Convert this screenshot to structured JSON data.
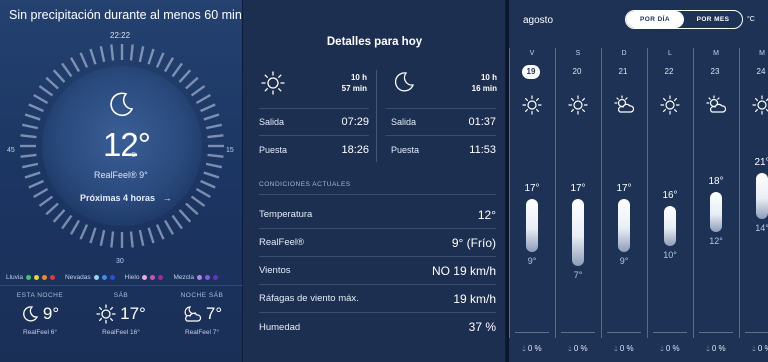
{
  "left": {
    "headline": "Sin precipitación durante al menos 60 min",
    "dial": {
      "time": "22:22",
      "right": "15",
      "left": "45",
      "bottom": "30"
    },
    "current": {
      "temp": "12°",
      "unit": "C",
      "realfeel": "RealFeel® 9°",
      "condition_icon": "moon-icon"
    },
    "next_hours": "Próximas 4 horas",
    "legend": [
      {
        "label": "Lluvia",
        "colors": [
          "#3fc46f",
          "#e6d43a",
          "#f08a2b",
          "#e23a3a"
        ]
      },
      {
        "label": "Nevadas",
        "colors": [
          "#8fd6f5",
          "#3a8ff0",
          "#2a4fd8"
        ]
      },
      {
        "label": "Hielo",
        "colors": [
          "#f2a7d6",
          "#d24fb0",
          "#a1279a"
        ]
      },
      {
        "label": "Mezcla",
        "colors": [
          "#b184f0",
          "#8a55e0",
          "#6630c8"
        ]
      }
    ],
    "forecasts": [
      {
        "label": "ESTA NOCHE",
        "temp": "9°",
        "realfeel": "RealFeel 6°",
        "icon": "moon-icon"
      },
      {
        "label": "SÁB",
        "temp": "17°",
        "realfeel": "RealFeel 16°",
        "icon": "sun-icon"
      },
      {
        "label": "NOCHE SÁB",
        "temp": "7°",
        "realfeel": "RealFeel 7°",
        "icon": "moon-cloud-icon"
      }
    ]
  },
  "details": {
    "title": "Detalles para hoy",
    "sun": {
      "duration_h": "10 h",
      "duration_m": "57 min",
      "rise_label": "Salida",
      "rise": "07:29",
      "set_label": "Puesta",
      "set": "18:26"
    },
    "moon": {
      "duration_h": "10 h",
      "duration_m": "16 min",
      "rise_label": "Salida",
      "rise": "01:37",
      "set_label": "Puesta",
      "set": "11:53"
    },
    "conditions_header": "CONDICIONES ACTUALES",
    "conditions": [
      {
        "label": "Temperatura",
        "value": "12°"
      },
      {
        "label": "RealFeel®",
        "value": "9° (Frío)"
      },
      {
        "label": "Vientos",
        "value": "NO 19 km/h"
      },
      {
        "label": "Ráfagas de viento máx.",
        "value": "19 km/h"
      },
      {
        "label": "Humedad",
        "value": "37 %"
      }
    ]
  },
  "daily": {
    "month": "agosto",
    "toggle": {
      "day": "POR DÍA",
      "month": "POR MES"
    },
    "unit": "°C",
    "days": [
      {
        "dow": "V",
        "date": "19",
        "selected": true,
        "icon": "sun-icon",
        "high": "17°",
        "low": "9°",
        "precip": "0 %"
      },
      {
        "dow": "S",
        "date": "20",
        "selected": false,
        "icon": "sun-icon",
        "high": "17°",
        "low": "7°",
        "precip": "0 %"
      },
      {
        "dow": "D",
        "date": "21",
        "selected": false,
        "icon": "sun-cloud-icon",
        "high": "17°",
        "low": "9°",
        "precip": "0 %"
      },
      {
        "dow": "L",
        "date": "22",
        "selected": false,
        "icon": "sun-icon",
        "high": "16°",
        "low": "10°",
        "precip": "0 %"
      },
      {
        "dow": "M",
        "date": "23",
        "selected": false,
        "icon": "sun-cloud-icon",
        "high": "18°",
        "low": "12°",
        "precip": "0 %"
      },
      {
        "dow": "M",
        "date": "24",
        "selected": false,
        "icon": "sun-icon",
        "high": "21°",
        "low": "14°",
        "precip": "0 %"
      }
    ]
  }
}
